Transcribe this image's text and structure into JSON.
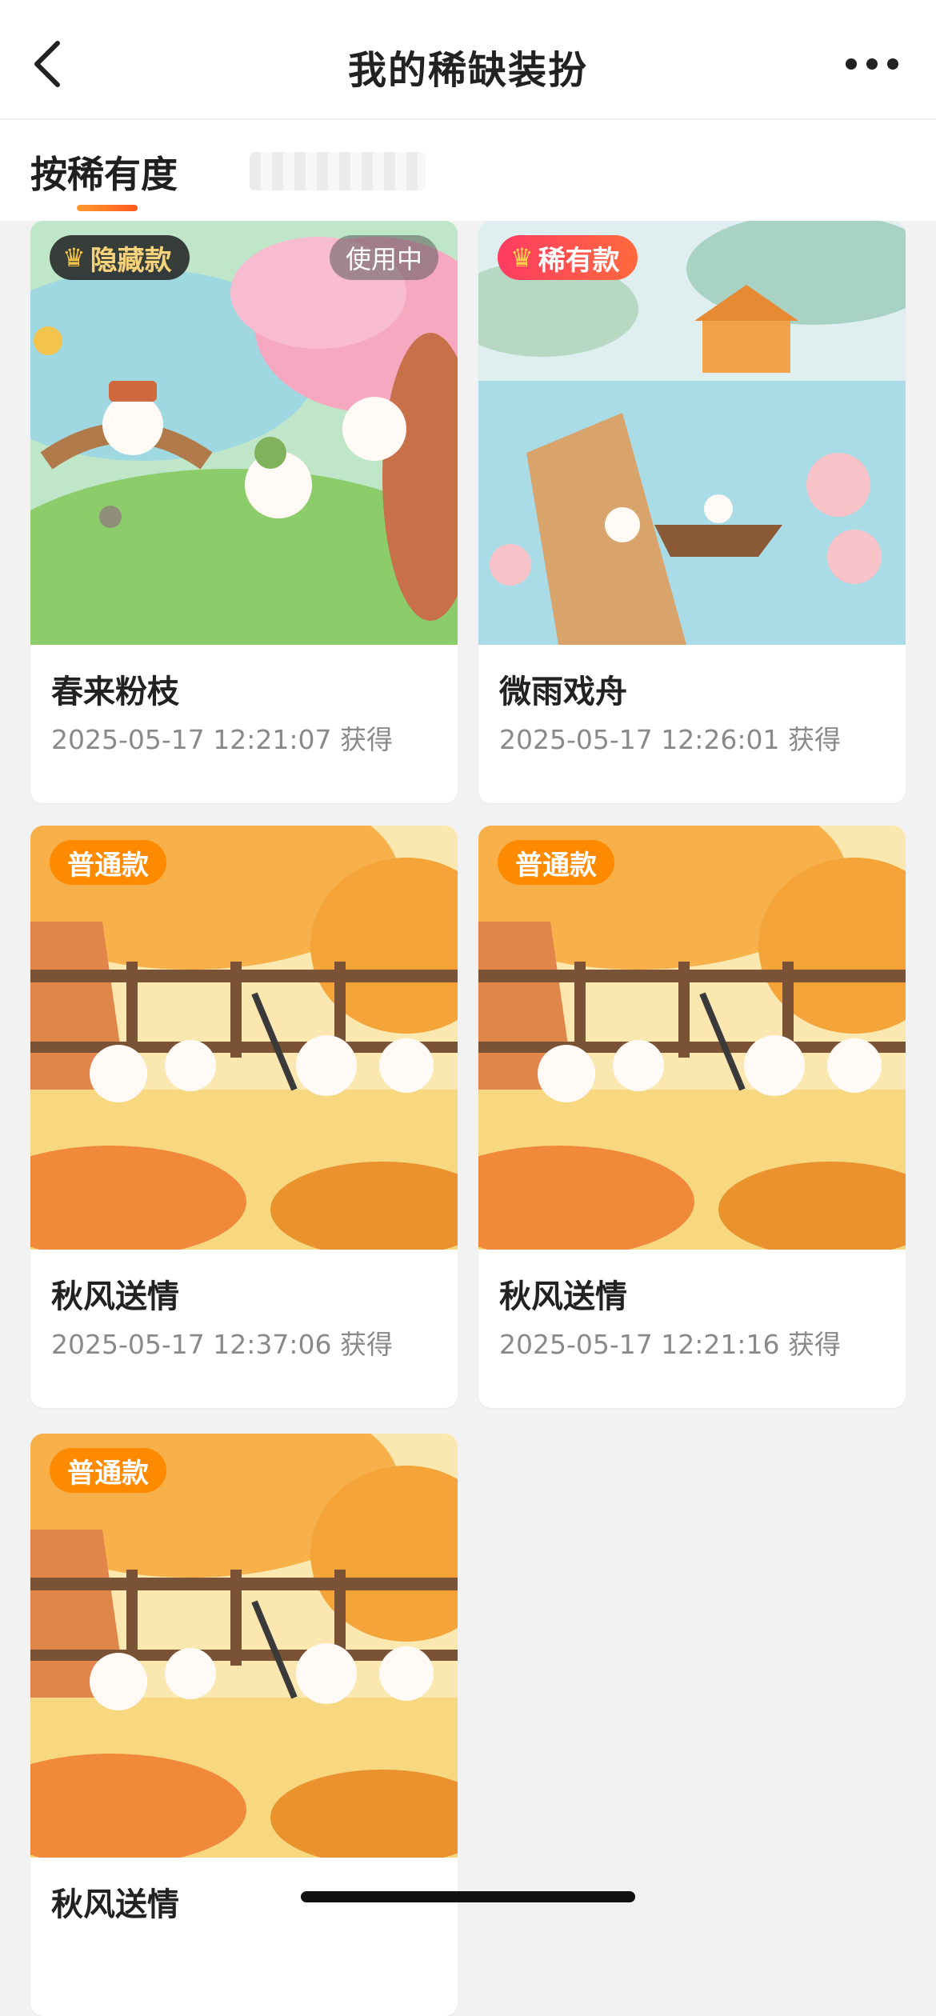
{
  "header": {
    "title": "我的稀缺装扮"
  },
  "tabs": {
    "active_label": "按稀有度"
  },
  "items": [
    {
      "badge": "隐藏款",
      "status": "使用中",
      "name": "春来粉枝",
      "time": "2025-05-17 12:21:07 获得"
    },
    {
      "badge": "稀有款",
      "name": "微雨戏舟",
      "time": "2025-05-17 12:26:01 获得"
    },
    {
      "badge": "普通款",
      "name": "秋风送情",
      "time": "2025-05-17 12:37:06 获得"
    },
    {
      "badge": "普通款",
      "name": "秋风送情",
      "time": "2025-05-17 12:21:16 获得"
    },
    {
      "badge": "普通款",
      "name": "秋风送情"
    }
  ],
  "colors": {
    "accent": "#ff8a00",
    "rare": "#ff3b62",
    "background": "#f2f2f2"
  }
}
